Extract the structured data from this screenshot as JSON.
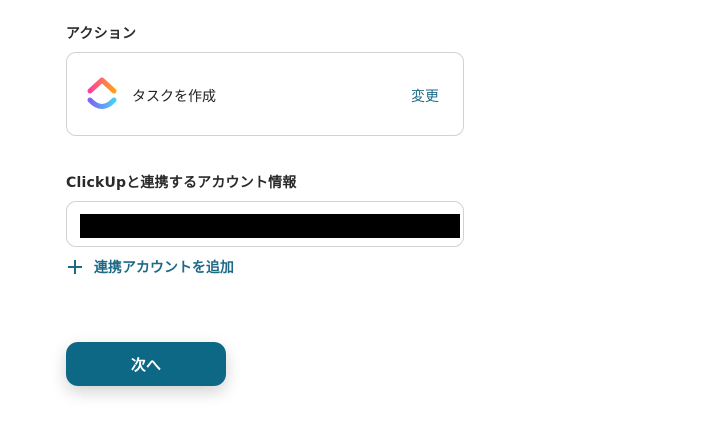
{
  "action_section": {
    "label": "アクション",
    "card": {
      "app_icon": "clickup-logo",
      "action_name": "タスクを作成",
      "change_label": "変更"
    }
  },
  "account_section": {
    "label": "ClickUpと連携するアカウント情報",
    "selected_account": "[redacted]",
    "add_account_label": "連携アカウントを追加"
  },
  "next_button_label": "次へ",
  "colors": {
    "accent": "#1d6a86",
    "button_bg": "#0d6885",
    "border": "#cfd3d7",
    "logo_gradient": [
      "#ff3fa0",
      "#ff9f1c",
      "#7b68ee",
      "#49ccf9"
    ]
  }
}
